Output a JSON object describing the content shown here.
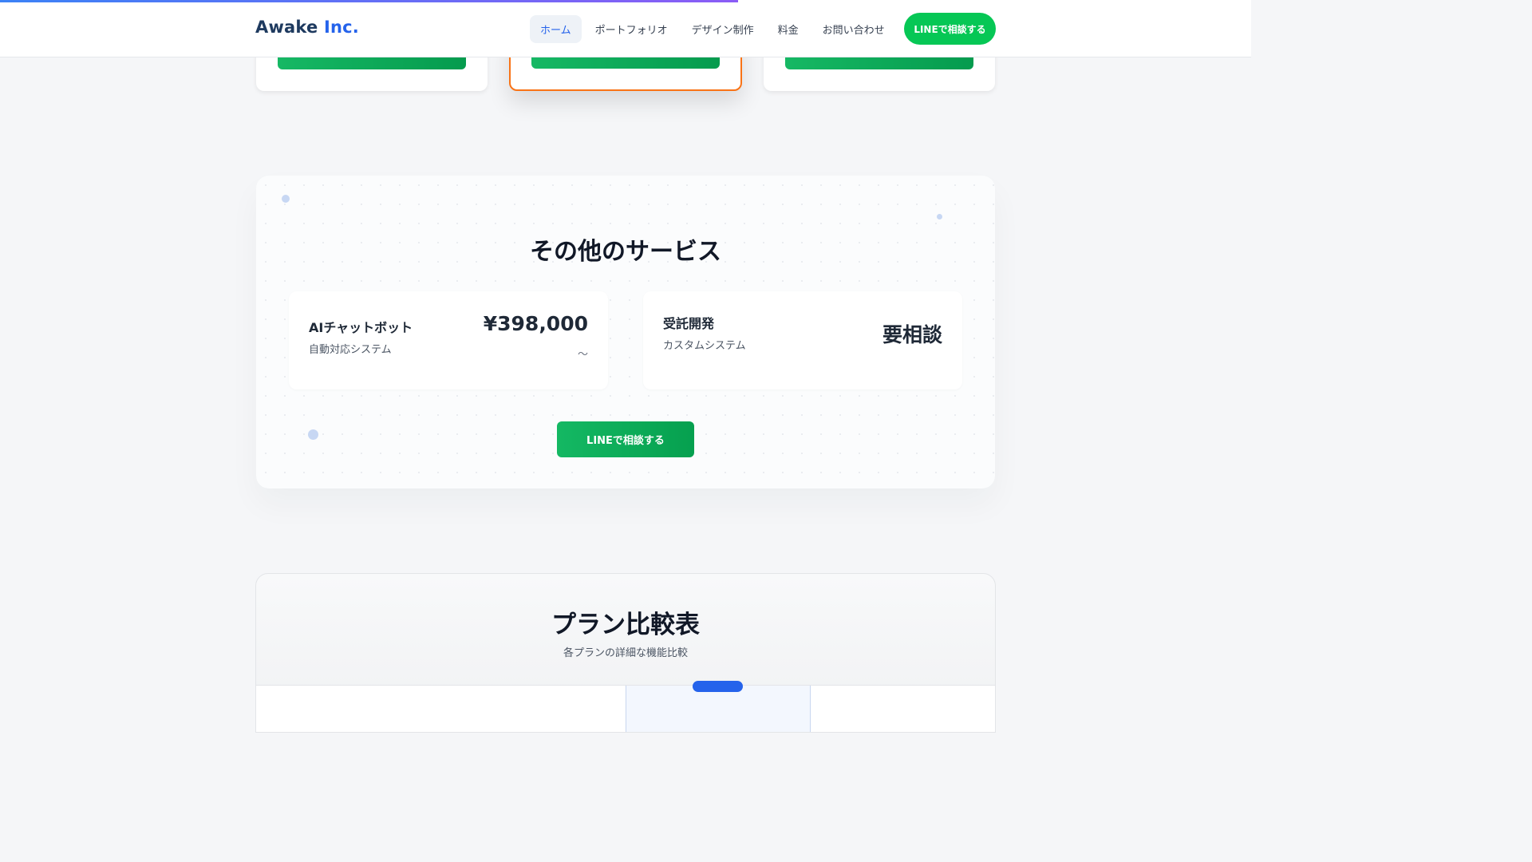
{
  "scroll_progress": 0.59,
  "header": {
    "logo_main": "Awake",
    "logo_suffix": "Inc.",
    "nav": [
      {
        "label": "ホーム",
        "active": true
      },
      {
        "label": "ポートフォリオ",
        "active": false
      },
      {
        "label": "デザイン制作",
        "active": false
      },
      {
        "label": "料金",
        "active": false
      },
      {
        "label": "お問い合わせ",
        "active": false
      }
    ],
    "cta_label": "LINEで相談する"
  },
  "services": {
    "title": "その他のサービス",
    "items": [
      {
        "name": "AIチャットボット",
        "description": "自動対応システム",
        "price": "¥398,000",
        "price_suffix": "〜"
      },
      {
        "name": "受託開発",
        "description": "カスタムシステム",
        "price": "要相談",
        "price_suffix": ""
      }
    ],
    "cta_label": "LINEで相談する"
  },
  "comparison": {
    "title": "プラン比較表",
    "subtitle": "各プランの詳細な機能比較"
  },
  "colors": {
    "line_green": "#06c755",
    "accent_blue": "#2563eb",
    "featured_border": "#f97316"
  }
}
